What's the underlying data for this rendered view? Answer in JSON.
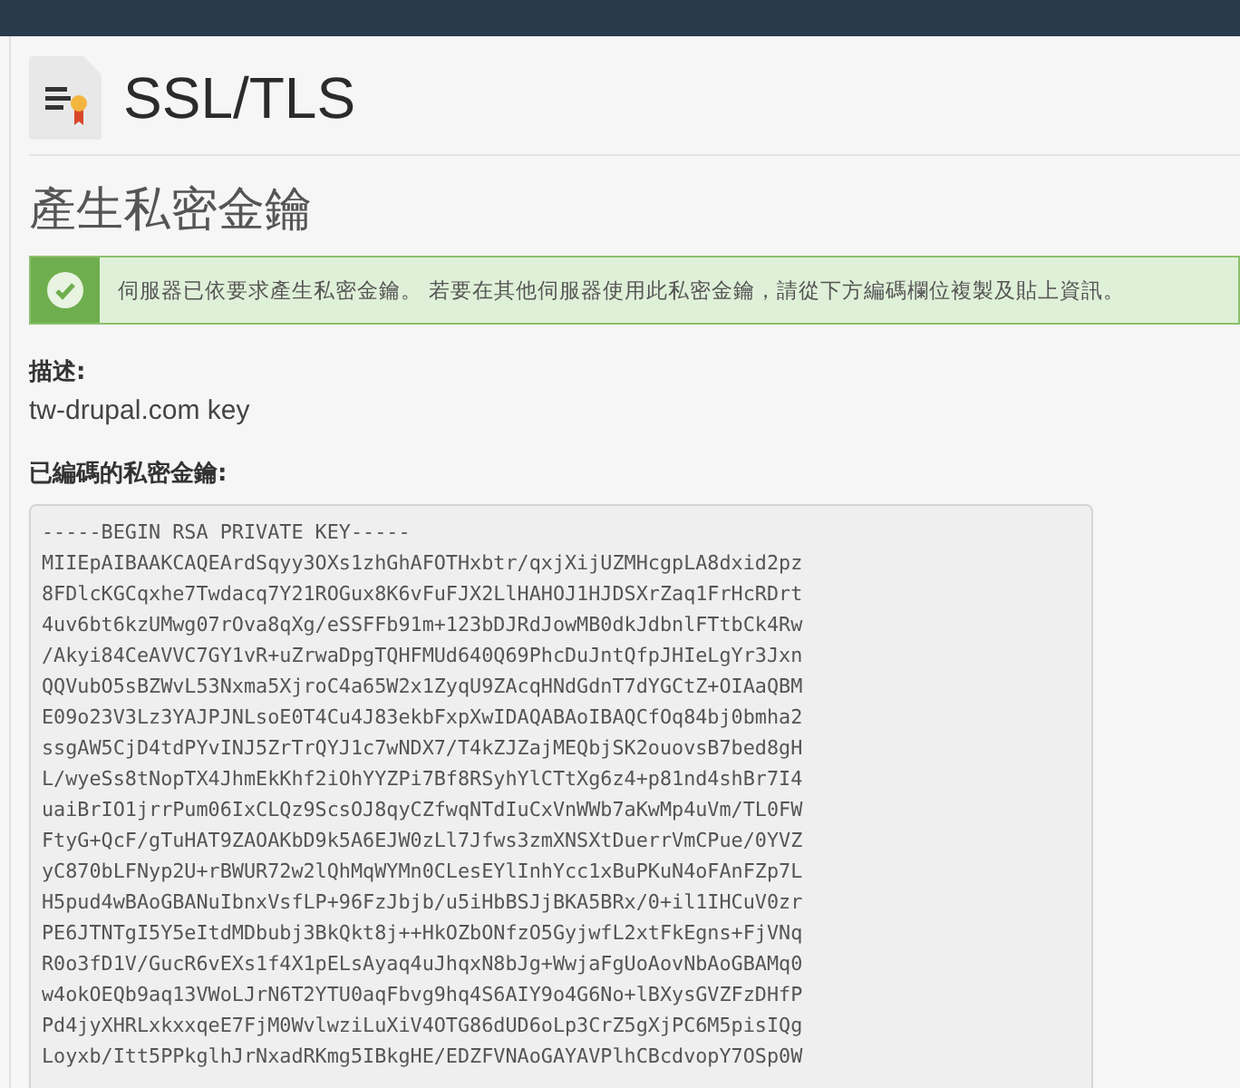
{
  "page_title": "SSL/TLS",
  "section_title": "產生私密金鑰",
  "alert": {
    "kind": "success",
    "message": "伺服器已依要求產生私密金鑰。 若要在其他伺服器使用此私密金鑰，請從下方編碼欄位複製及貼上資訊。"
  },
  "description": {
    "label": "描述:",
    "value": "tw-drupal.com key"
  },
  "encoded_key": {
    "label": "已編碼的私密金鑰:",
    "lines": [
      "-----BEGIN RSA PRIVATE KEY-----",
      "MIIEpAIBAAKCAQEArdSqyy3OXs1zhGhAFOTHxbtr/qxjXijUZMHcgpLA8dxid2pz",
      "8FDlcKGCqxhe7Twdacq7Y21ROGux8K6vFuFJX2LlHAHOJ1HJDSXrZaq1FrHcRDrt",
      "4uv6bt6kzUMwg07rOva8qXg/eSSFFb91m+123bDJRdJowMB0dkJdbnlFTtbCk4Rw",
      "/Akyi84CeAVVC7GY1vR+uZrwaDpgTQHFMUd640Q69PhcDuJntQfpJHIeLgYr3Jxn",
      "QQVubO5sBZWvL53Nxma5XjroC4a65W2x1ZyqU9ZAcqHNdGdnT7dYGCtZ+OIAaQBM",
      "E09o23V3Lz3YAJPJNLsoE0T4Cu4J83ekbFxpXwIDAQABAoIBAQCfOq84bj0bmha2",
      "ssgAW5CjD4tdPYvINJ5ZrTrQYJ1c7wNDX7/T4kZJZajMEQbjSK2ouovsB7bed8gH",
      "L/wyeSs8tNopTX4JhmEkKhf2iOhYYZPi7Bf8RSyhYlCTtXg6z4+p81nd4shBr7I4",
      "uaiBrIO1jrrPum06IxCLQz9ScsOJ8qyCZfwqNTdIuCxVnWWb7aKwMp4uVm/TL0FW",
      "FtyG+QcF/gTuHAT9ZAOAKbD9k5A6EJW0zLl7Jfws3zmXNSXtDuerrVmCPue/0YVZ",
      "yC870bLFNyp2U+rBWUR72w2lQhMqWYMn0CLesEYlInhYcc1xBuPKuN4oFAnFZp7L",
      "H5pud4wBAoGBANuIbnxVsfLP+96FzJbjb/u5iHbBSJjBKA5BRx/0+il1IHCuV0zr",
      "PE6JTNTgI5Y5eItdMDbubj3BkQkt8j++HkOZbONfzO5GyjwfL2xtFkEgns+FjVNq",
      "R0o3fD1V/GucR6vEXs1f4X1pELsAyaq4uJhqxN8bJg+WwjaFgUoAovNbAoGBAMq0",
      "w4okOEQb9aq13VWoLJrN6T2YTU0aqFbvg9hq4S6AIY9o4G6No+lBXysGVZFzDHfP",
      "Pd4jyXHRLxkxxqeE7FjM0WvlwziLuXiV4OTG86dUD6oLp3CrZ5gXjPC6M5pisIQg",
      "Loyxb/Itt5PPkglhJrNxadRKmg5IBkgHE/EDZFVNAoGAYAVPlhCBcdvopY7OSp0W"
    ]
  }
}
